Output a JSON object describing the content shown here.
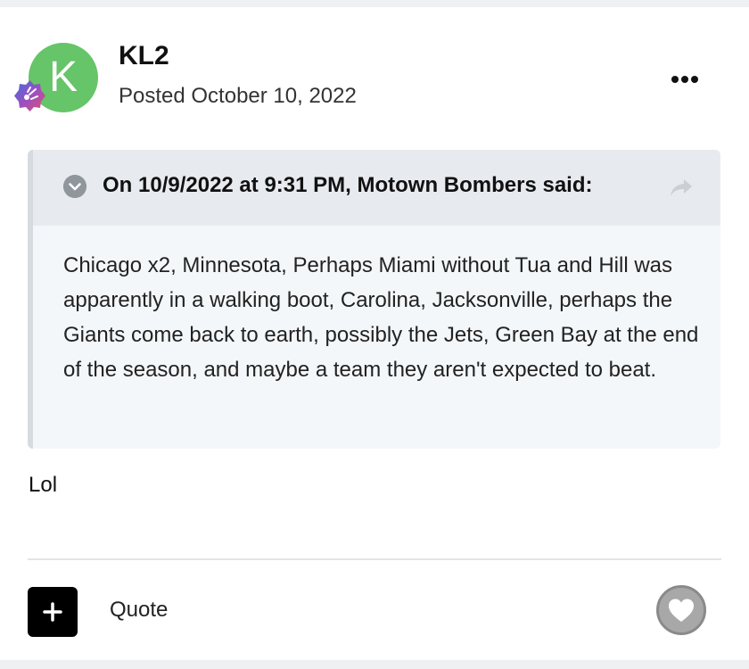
{
  "post": {
    "avatar_letter": "K",
    "author": "KL2",
    "posted": "Posted October 10, 2022",
    "more_icon": "ellipsis-icon"
  },
  "quote": {
    "citation": "On 10/9/2022 at 9:31 PM, Motown Bombers said:",
    "text": "Chicago x2, Minnesota, Perhaps Miami without Tua and Hill was apparently in a walking boot, Carolina, Jacksonville, perhaps the Giants come back to earth, possibly the Jets, Green Bay at the end of the season, and maybe a team they aren't expected to beat."
  },
  "reply": {
    "text": "Lol"
  },
  "actions": {
    "quote_label": "Quote"
  },
  "colors": {
    "avatar": "#66c469",
    "quote_bg": "#f4f7fa",
    "quote_header_bg": "#e7ebef",
    "like_button": "#a8a8a8"
  }
}
